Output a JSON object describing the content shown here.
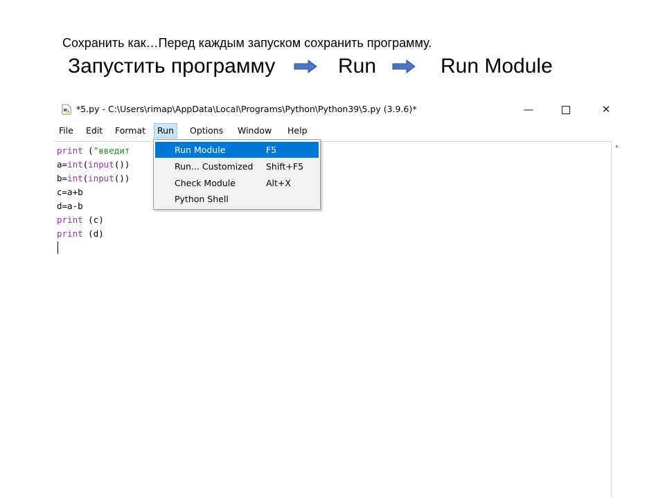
{
  "slide": {
    "note": "Сохранить как…Перед каждым запуском сохранить программу.",
    "steps": [
      "Запустить программу",
      "Run",
      "Run Module"
    ],
    "arrow_color": "#4a74c4"
  },
  "window": {
    "title": "*5.py - C:\\Users\\rimap\\AppData\\Local\\Programs\\Python\\Python39\\5.py (3.9.6)*",
    "controls": {
      "minimize": "—",
      "maximize": "",
      "close": "✕"
    }
  },
  "menubar": [
    "File",
    "Edit",
    "Format",
    "Run",
    "Options",
    "Window",
    "Help"
  ],
  "active_menu": "Run",
  "code": {
    "line1": {
      "kw": "print",
      "rest": " (",
      "str": "\"введит"
    },
    "line2": {
      "a": "a=",
      "kw1": "int",
      "b": "(",
      "kw2": "input",
      "c": "())"
    },
    "line3": {
      "a": "b=",
      "kw1": "int",
      "b": "(",
      "kw2": "input",
      "c": "())"
    },
    "line4": "c=a+b",
    "line5": "d=a-b",
    "line6": {
      "kw": "print",
      "rest": " (c)"
    },
    "line7": {
      "kw": "print",
      "rest": " (d)"
    }
  },
  "run_menu": [
    {
      "label": "Run Module",
      "shortcut": "F5"
    },
    {
      "label": "Run... Customized",
      "shortcut": "Shift+F5"
    },
    {
      "label": "Check Module",
      "shortcut": "Alt+X"
    },
    {
      "label": "Python Shell",
      "shortcut": ""
    }
  ],
  "colors": {
    "keyword": "#9b2fae",
    "string": "#1f8c1f",
    "menu_highlight": "#0078d7"
  }
}
